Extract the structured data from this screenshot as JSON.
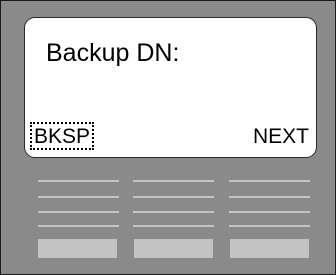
{
  "screen": {
    "prompt": "Backup DN:",
    "softkeys": {
      "left_label": "BKSP",
      "right_label": "NEXT"
    }
  },
  "colors": {
    "panel": "#8a8a8a",
    "screen": "#ffffff",
    "keys": "#c2c2c2"
  }
}
